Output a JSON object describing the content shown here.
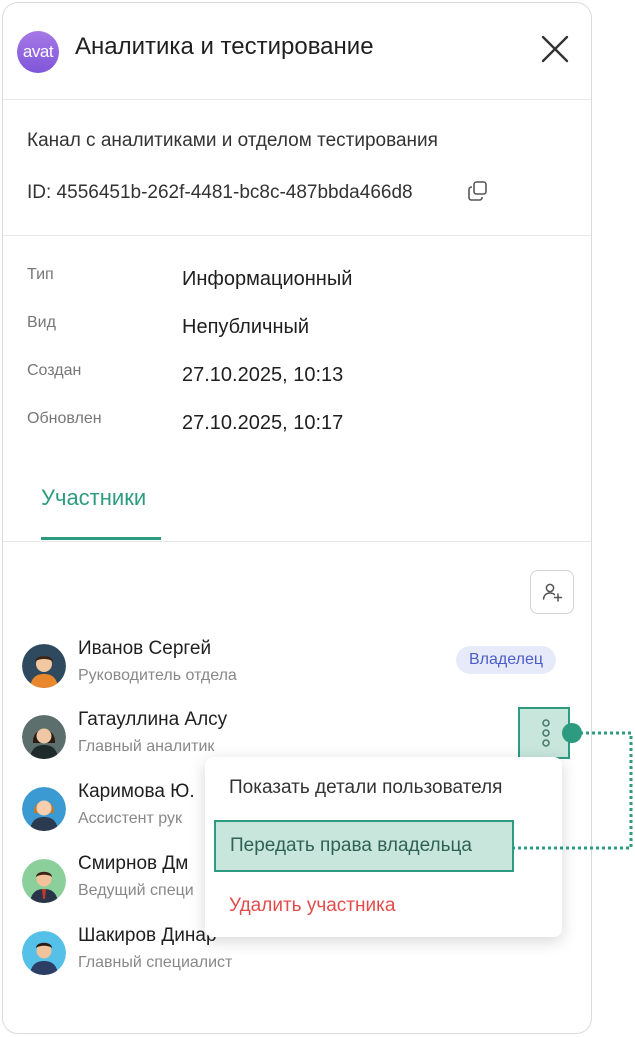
{
  "header": {
    "avatar_text": "avat",
    "title": "Аналитика и тестирование",
    "close_icon": "close-icon"
  },
  "info": {
    "description": "Канал с аналитиками и отделом тестирования",
    "id_text": "ID: 4556451b-262f-4481-bc8c-487bbda466d8",
    "copy_icon": "copy-icon"
  },
  "properties": [
    {
      "label": "Тип",
      "value": "Информационный"
    },
    {
      "label": "Вид",
      "value": "Непубличный"
    },
    {
      "label": "Создан",
      "value": "27.10.2025, 10:13"
    },
    {
      "label": "Обновлен",
      "value": "27.10.2025, 10:17"
    }
  ],
  "tabs": {
    "members_label": "Участники"
  },
  "actions": {
    "add_user_icon": "add-user-icon"
  },
  "members": [
    {
      "name": "Иванов Сергей",
      "role": "Руководитель отдела",
      "badge": "Владелец"
    },
    {
      "name": "Гатауллина Алсу",
      "role": "Главный аналитик"
    },
    {
      "name": "Каримова Ю.",
      "role": "Ассистент рук"
    },
    {
      "name": "Смирнов Дм",
      "role": "Ведущий специ"
    },
    {
      "name": "Шакиров Динар",
      "role": "Главный специалист"
    }
  ],
  "context_menu": {
    "show_details": "Показать детали пользователя",
    "transfer_owner": "Передать права владельца",
    "delete_member": "Удалить участника"
  },
  "colors": {
    "accent": "#2d9b7f",
    "highlight": "#c8e6dc",
    "danger": "#e34b4b",
    "badge_bg": "#e7ebf9",
    "badge_text": "#4b5dc9"
  }
}
